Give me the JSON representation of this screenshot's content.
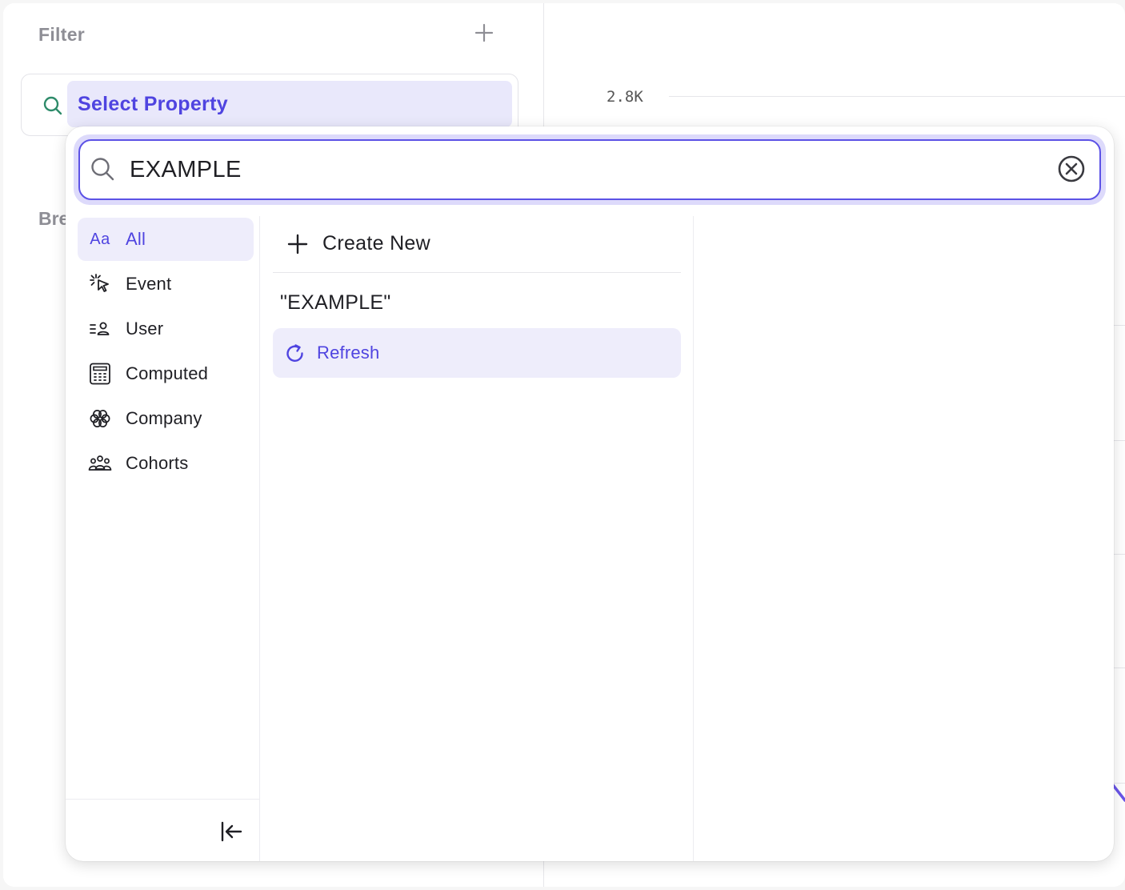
{
  "background": {
    "filter": {
      "title": "Filter",
      "add_icon": "plus-icon"
    },
    "select_property": {
      "label": "Select Property",
      "icon": "search-icon"
    },
    "breakdown_fragment": "Bre",
    "chart": {
      "tick_label": "2.8K"
    }
  },
  "popup": {
    "search": {
      "value": "EXAMPLE",
      "icon": "search-icon",
      "clear_icon": "clear-circle-icon"
    },
    "categories": [
      {
        "label": "All",
        "icon_text": "Aa",
        "icon": "aa-text-icon",
        "active": true
      },
      {
        "label": "Event",
        "icon": "cursor-click-icon",
        "active": false
      },
      {
        "label": "User",
        "icon": "user-list-icon",
        "active": false
      },
      {
        "label": "Computed",
        "icon": "calculator-icon",
        "active": false
      },
      {
        "label": "Company",
        "icon": "flower-icon",
        "active": false
      },
      {
        "label": "Cohorts",
        "icon": "group-icon",
        "active": false
      }
    ],
    "collapse_icon": "collapse-left-icon",
    "results": {
      "create_new_label": "Create New",
      "query_label": "\"EXAMPLE\"",
      "refresh_label": "Refresh"
    }
  },
  "colors": {
    "accent": "#5c52e6",
    "accent_text": "#4f44e0",
    "accent_bg": "#eeedfb",
    "filter_search_icon": "#2e8b6a",
    "chart_line": "#6a55e8"
  }
}
